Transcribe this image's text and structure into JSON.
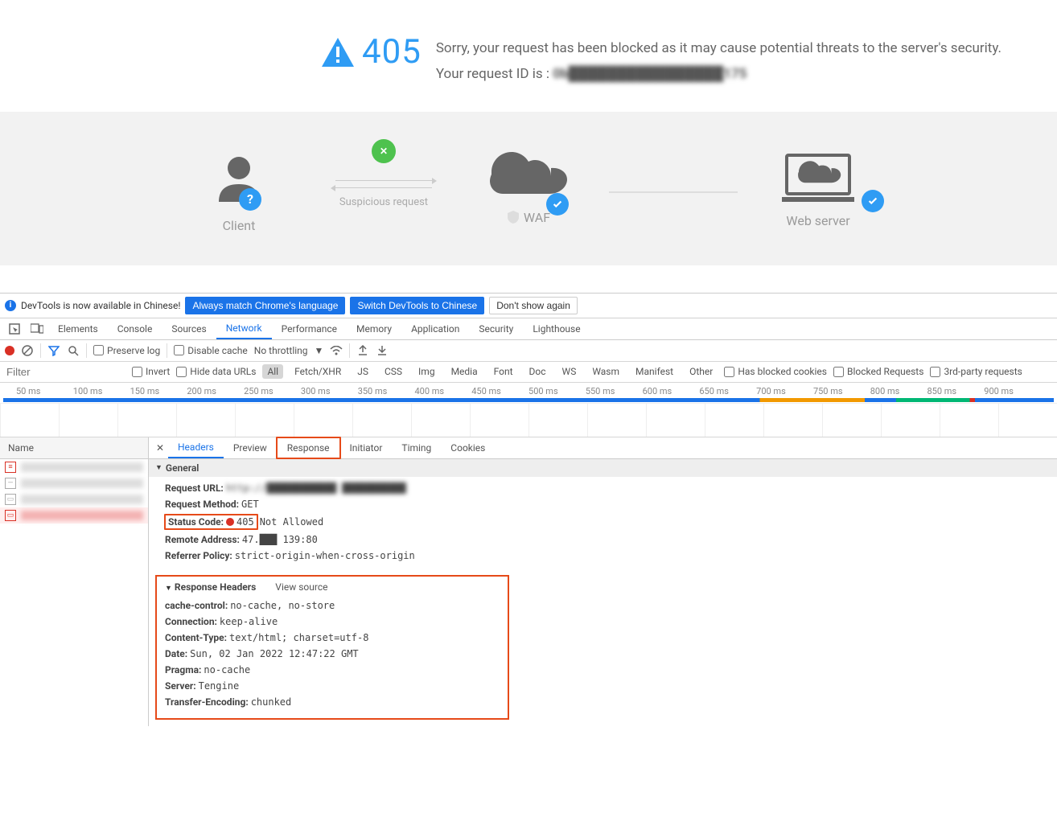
{
  "page": {
    "error_code": "405",
    "message": "Sorry, your request has been blocked as it may cause potential threats to the server's security.",
    "request_id_label": "Your request ID is : ",
    "request_id_value": "0b████████████████175",
    "diagram": {
      "client": "Client",
      "susp": "Suspicious request",
      "waf": "WAF",
      "server": "Web server"
    }
  },
  "devtools": {
    "banner": {
      "text": "DevTools is now available in Chinese!",
      "btn_match": "Always match Chrome's language",
      "btn_switch": "Switch DevTools to Chinese",
      "btn_dont": "Don't show again"
    },
    "tabs": [
      "Elements",
      "Console",
      "Sources",
      "Network",
      "Performance",
      "Memory",
      "Application",
      "Security",
      "Lighthouse"
    ],
    "active_tab": "Network",
    "toolbar": {
      "preserve": "Preserve log",
      "disable_cache": "Disable cache",
      "throttling": "No throttling"
    },
    "filter": {
      "placeholder": "Filter",
      "invert": "Invert",
      "hide_data": "Hide data URLs",
      "types": [
        "All",
        "Fetch/XHR",
        "JS",
        "CSS",
        "Img",
        "Media",
        "Font",
        "Doc",
        "WS",
        "Wasm",
        "Manifest",
        "Other"
      ],
      "active_type": "All",
      "blocked_cookies": "Has blocked cookies",
      "blocked_requests": "Blocked Requests",
      "third_party": "3rd-party requests"
    },
    "timeline": [
      "50 ms",
      "100 ms",
      "150 ms",
      "200 ms",
      "250 ms",
      "300 ms",
      "350 ms",
      "400 ms",
      "450 ms",
      "500 ms",
      "550 ms",
      "600 ms",
      "650 ms",
      "700 ms",
      "750 ms",
      "800 ms",
      "850 ms",
      "900 ms"
    ],
    "name_header": "Name",
    "detail_tabs": [
      "Headers",
      "Preview",
      "Response",
      "Initiator",
      "Timing",
      "Cookies"
    ],
    "active_detail_tab": "Headers",
    "highlighted_detail_tab": "Response",
    "general": {
      "title": "General",
      "request_url_k": "Request URL:",
      "request_url_v": "http://████████████  ███████████",
      "method_k": "Request Method:",
      "method_v": "GET",
      "status_k": "Status Code:",
      "status_v": "405",
      "status_txt": "Not Allowed",
      "remote_k": "Remote Address:",
      "remote_v": "47.███ 139:80",
      "refpol_k": "Referrer Policy:",
      "refpol_v": "strict-origin-when-cross-origin"
    },
    "response_headers": {
      "title": "Response Headers",
      "view_source": "View source",
      "items": [
        {
          "k": "cache-control:",
          "v": "no-cache, no-store"
        },
        {
          "k": "Connection:",
          "v": "keep-alive"
        },
        {
          "k": "Content-Type:",
          "v": "text/html; charset=utf-8"
        },
        {
          "k": "Date:",
          "v": "Sun, 02 Jan 2022 12:47:22 GMT"
        },
        {
          "k": "Pragma:",
          "v": "no-cache"
        },
        {
          "k": "Server:",
          "v": "Tengine"
        },
        {
          "k": "Transfer-Encoding:",
          "v": "chunked"
        }
      ]
    }
  }
}
